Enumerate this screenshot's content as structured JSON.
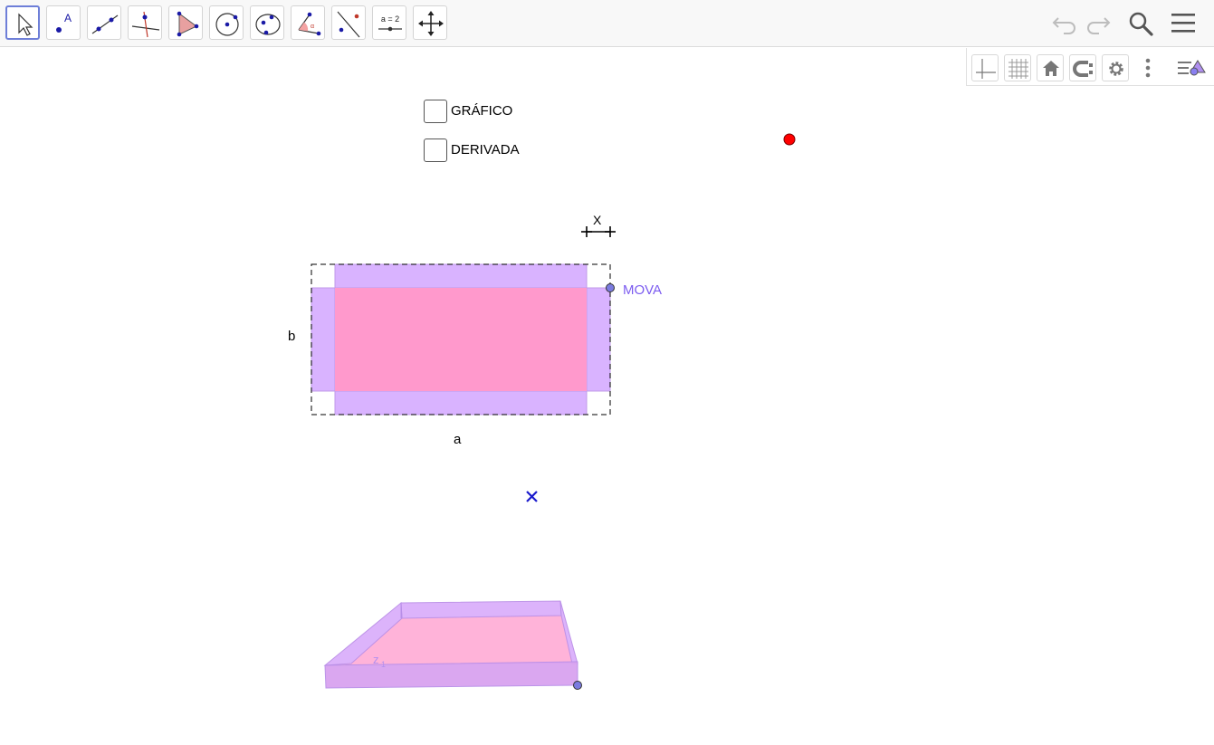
{
  "toolbar": {
    "tools": [
      {
        "name": "move-tool",
        "label": "Move",
        "selected": true
      },
      {
        "name": "point-tool",
        "label": "Point"
      },
      {
        "name": "line-tool",
        "label": "Line"
      },
      {
        "name": "perpendicular-line-tool",
        "label": "Perpendicular Line"
      },
      {
        "name": "polygon-tool",
        "label": "Polygon"
      },
      {
        "name": "circle-center-point-tool",
        "label": "Circle with Center through Point"
      },
      {
        "name": "ellipse-tool",
        "label": "Ellipse"
      },
      {
        "name": "angle-tool",
        "label": "Angle"
      },
      {
        "name": "reflect-tool",
        "label": "Reflect about Line"
      },
      {
        "name": "slider-tool",
        "label": "Slider",
        "icon_text": "a = 2"
      },
      {
        "name": "move-graphics-view-tool",
        "label": "Move Graphics View"
      }
    ],
    "right": [
      "undo-icon",
      "redo-icon",
      "search-icon",
      "menu-icon"
    ]
  },
  "graphics_style_bar": {
    "buttons": [
      "axes-icon",
      "grid-icon",
      "home-icon",
      "point-capturing-icon",
      "settings-icon",
      "more-icon",
      "style-bar-toggle-icon"
    ]
  },
  "checkboxes": [
    {
      "label": "GRÁFICO",
      "checked": false
    },
    {
      "label": "DERIVADA",
      "checked": false
    }
  ],
  "labels": {
    "x_label": "X",
    "b_label": "b",
    "a_label": "a",
    "mova_label": "MOVA",
    "z_label": "z",
    "z_subscript": "1"
  },
  "colors": {
    "accent": "#6e7fd8",
    "purple_fill": "#d9b3ff",
    "pink_fill": "#ff99cc",
    "point_purple": "#7b7be0",
    "mova_text": "#7c5cf0",
    "red_point": "#ff0000",
    "blue_cross": "#1a1acc"
  }
}
